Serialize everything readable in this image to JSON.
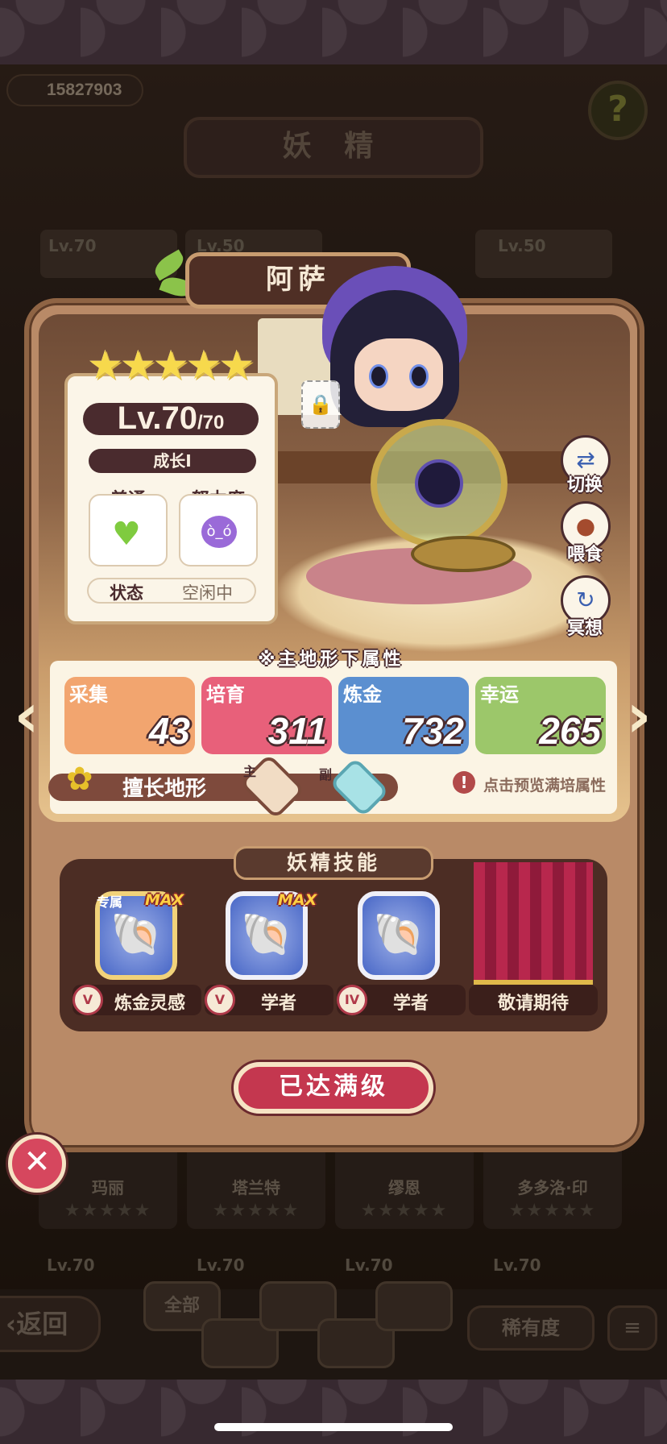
{
  "header": {
    "coins": "15827903",
    "title": "妖 精",
    "help_glyph": "?"
  },
  "background_cards_top": [
    {
      "level": "Lv.70"
    },
    {
      "level": "Lv.50"
    },
    {
      "level": "Lv.50"
    }
  ],
  "background_cards_bottom": [
    {
      "name": "玛丽",
      "stars": "★★★★★",
      "level": "Lv.70"
    },
    {
      "name": "塔兰特",
      "stars": "★★★★★",
      "level": "Lv.70"
    },
    {
      "name": "缪恩",
      "stars": "★★★★★",
      "level": "Lv.70"
    },
    {
      "name": "多多洛·印",
      "stars": "★★★★★",
      "level": "Lv.70"
    }
  ],
  "fairy": {
    "name": "阿萨",
    "stars": "★★★★★",
    "level": "Lv.70",
    "level_max": "/70",
    "growth": "成长I",
    "stat1_label": "普通",
    "stat2_label": "努力度",
    "status_label": "状态",
    "status_value": "空闲中"
  },
  "side_actions": [
    {
      "label": "切换",
      "icon": "switch-icon"
    },
    {
      "label": "喂食",
      "icon": "meat-icon"
    },
    {
      "label": "冥想",
      "icon": "meditate-icon"
    }
  ],
  "terrain": {
    "title": "※主地形下属性",
    "attributes": [
      {
        "label": "采集",
        "value": "43",
        "color": "#f2a56f"
      },
      {
        "label": "培育",
        "value": "311",
        "color": "#e8607a"
      },
      {
        "label": "炼金",
        "value": "732",
        "color": "#5b8fd0"
      },
      {
        "label": "幸运",
        "value": "265",
        "color": "#9cc76a"
      }
    ],
    "specialty_label": "擅长地形",
    "main_tag": "主",
    "sub_tag": "副",
    "preview_tip": "点击预览满培属性"
  },
  "skills": {
    "title": "妖精技能",
    "items": [
      {
        "name": "炼金灵感",
        "rank": "V",
        "max": "MAX",
        "exclusive": "专属"
      },
      {
        "name": "学者",
        "rank": "V",
        "max": "MAX"
      },
      {
        "name": "学者",
        "rank": "IV"
      },
      {
        "name": "敬请期待"
      }
    ]
  },
  "max_level_button": "已达满级",
  "close_glyph": "✕",
  "bottom_bar": {
    "back": "返回",
    "filter_all": "全部",
    "rarity": "稀有度",
    "sort_icon": "≡"
  }
}
